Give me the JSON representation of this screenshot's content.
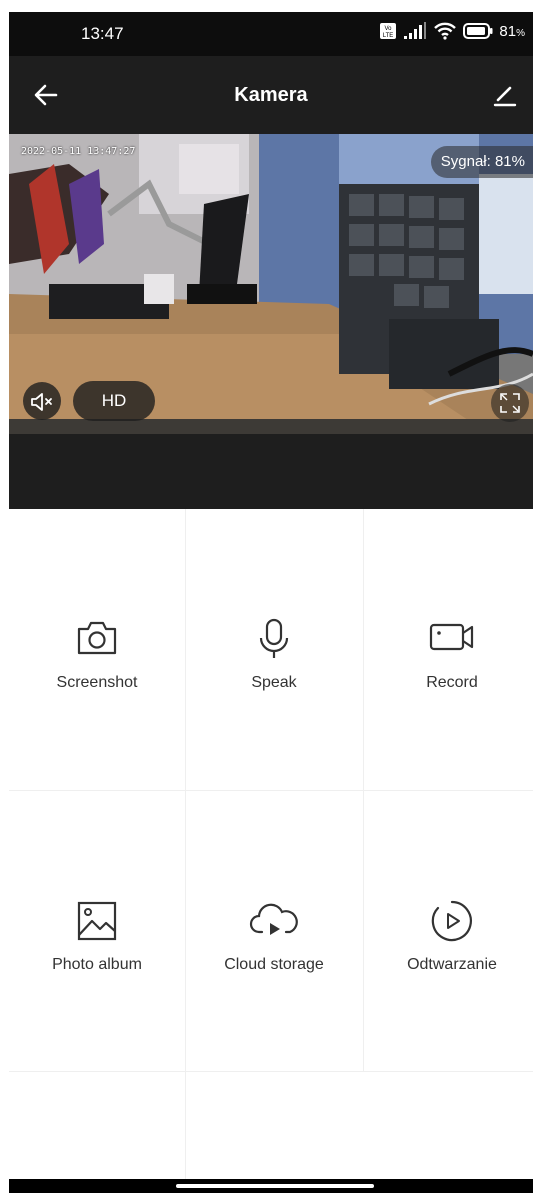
{
  "status_bar": {
    "time": "13:47",
    "volte_badge": "Vo LTE",
    "battery_percent": "81",
    "battery_unit": "%"
  },
  "app_bar": {
    "title": "Kamera"
  },
  "video": {
    "timestamp": "2022-05-11 13:47:27",
    "signal_label": "Sygnał: 81%",
    "quality_label": "HD"
  },
  "actions": [
    {
      "label": "Screenshot",
      "icon": "camera-icon"
    },
    {
      "label": "Speak",
      "icon": "microphone-icon"
    },
    {
      "label": "Record",
      "icon": "video-camera-icon"
    },
    {
      "label": "Photo album",
      "icon": "image-icon"
    },
    {
      "label": "Cloud storage",
      "icon": "cloud-play-icon"
    },
    {
      "label": "Odtwarzanie",
      "icon": "playback-icon"
    }
  ],
  "colors": {
    "app_bar_bg": "#1e1e1e",
    "status_bar_bg": "#0d0d0d",
    "icon_color": "#333333"
  }
}
